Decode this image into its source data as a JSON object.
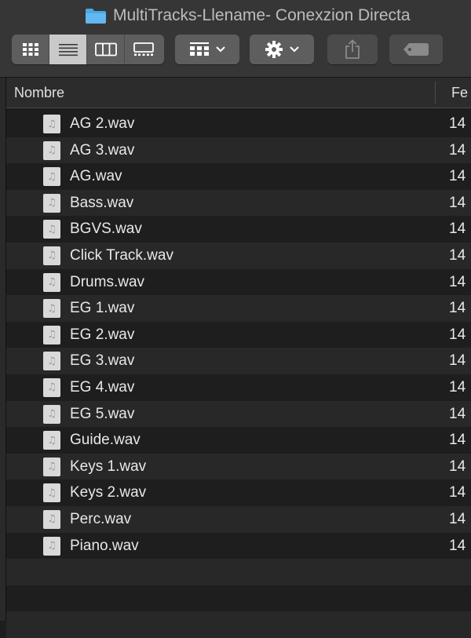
{
  "window": {
    "title": "MultiTracks-Llename- Conexzion Directa",
    "folder_color": "#4aa8e8"
  },
  "toolbar": {
    "view_modes": [
      "icon-view-icon",
      "list-view-icon",
      "column-view-icon",
      "gallery-view-icon"
    ],
    "active_view": "list-view-icon",
    "group_icon": "group-by-icon",
    "action_icon": "gear-icon",
    "share_icon": "share-icon",
    "tag_icon": "tag-icon"
  },
  "columns": {
    "name": "Nombre",
    "date": "Fe"
  },
  "files": [
    {
      "name": "AG 2.wav",
      "date": "14"
    },
    {
      "name": "AG 3.wav",
      "date": "14"
    },
    {
      "name": "AG.wav",
      "date": "14"
    },
    {
      "name": "Bass.wav",
      "date": "14"
    },
    {
      "name": "BGVS.wav",
      "date": "14"
    },
    {
      "name": "Click Track.wav",
      "date": "14"
    },
    {
      "name": "Drums.wav",
      "date": "14"
    },
    {
      "name": "EG 1.wav",
      "date": "14"
    },
    {
      "name": "EG 2.wav",
      "date": "14"
    },
    {
      "name": "EG 3.wav",
      "date": "14"
    },
    {
      "name": "EG 4.wav",
      "date": "14"
    },
    {
      "name": "EG 5.wav",
      "date": "14"
    },
    {
      "name": "Guide.wav",
      "date": "14"
    },
    {
      "name": "Keys 1.wav",
      "date": "14"
    },
    {
      "name": "Keys 2.wav",
      "date": "14"
    },
    {
      "name": "Perc.wav",
      "date": "14"
    },
    {
      "name": "Piano.wav",
      "date": "14"
    }
  ],
  "file_icon_glyph": "♫"
}
